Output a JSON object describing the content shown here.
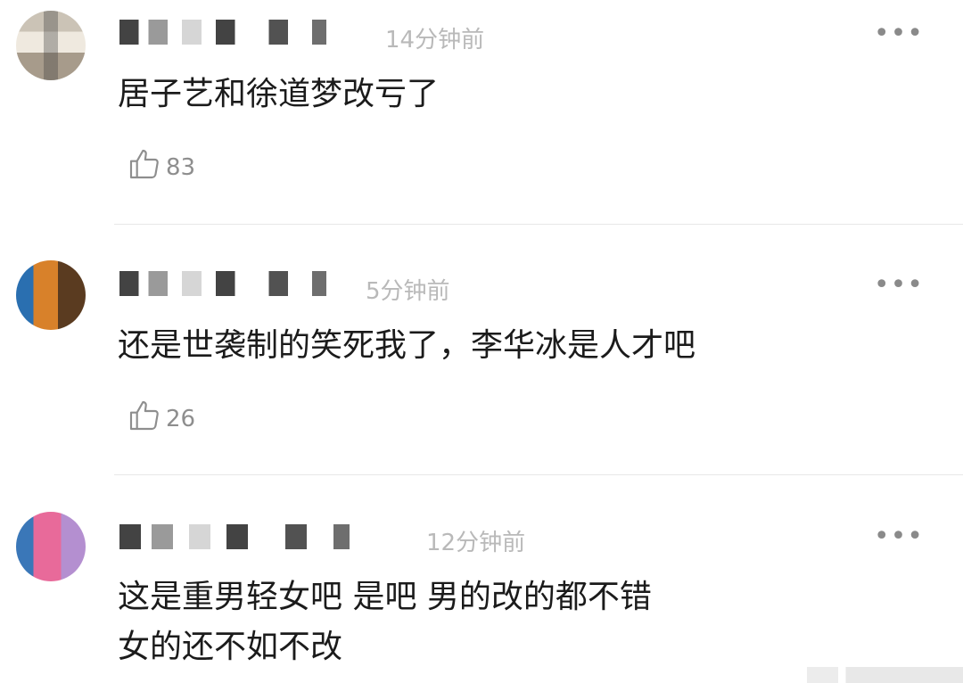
{
  "comments": [
    {
      "time": "14分钟前",
      "text_lines": [
        "居子艺和徐道梦改亏了"
      ],
      "likes": "83",
      "more": "•••"
    },
    {
      "time": "5分钟前",
      "text_lines": [
        "还是世袭制的笑死我了，李华冰是人才吧"
      ],
      "likes": "26",
      "more": "•••"
    },
    {
      "time": "12分钟前",
      "text_lines": [
        "这是重男轻女吧 是吧 男的改的都不错",
        "女的还不如不改"
      ],
      "more": "•••"
    }
  ],
  "icons": {
    "like": "thumbs-up-outline-icon",
    "more": "more-dots-icon"
  },
  "colors": {
    "text": "#1b1b1b",
    "meta": "#b9b9b9",
    "icon": "#8e8e8e"
  }
}
